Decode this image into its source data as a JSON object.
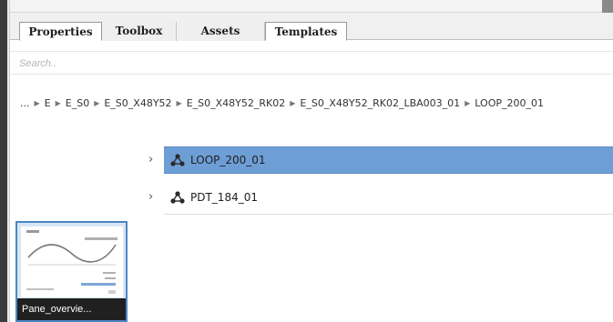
{
  "tabs": [
    {
      "label": "Properties",
      "state": "active"
    },
    {
      "label": "Toolbox",
      "state": "inactive"
    },
    {
      "label": "Assets",
      "state": "inactive"
    },
    {
      "label": "Templates",
      "state": "raised"
    }
  ],
  "search": {
    "placeholder": "Search.."
  },
  "breadcrumb": {
    "leading": "...",
    "items": [
      "E",
      "E_S0",
      "E_S0_X48Y52",
      "E_S0_X48Y52_RK02",
      "E_S0_X48Y52_RK02_LBA003_01",
      "LOOP_200_01"
    ]
  },
  "tree": {
    "rows": [
      {
        "label": "LOOP_200_01",
        "selected": true,
        "icon": "network-node-icon"
      },
      {
        "label": "PDT_184_01",
        "selected": false,
        "icon": "network-node-icon"
      }
    ]
  },
  "assets": [
    {
      "caption": "Pane_overvie..."
    }
  ],
  "colors": {
    "selection": "#6e9ed6",
    "thumb_border": "#4b86c4"
  }
}
